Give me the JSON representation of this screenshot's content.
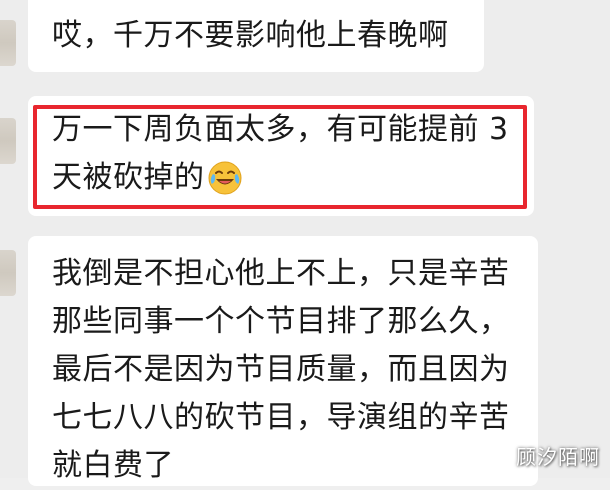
{
  "chat": {
    "messages": [
      {
        "lines": [
          "哎，千万不要影响他上春晚啊"
        ]
      },
      {
        "lines": [
          "万一下周负面太多，有可能提前 3",
          "天被砍掉的"
        ],
        "emoji": "crying-laughing-face-icon"
      },
      {
        "lines": [
          "我倒是不担心他上不上，只是辛苦",
          "那些同事一个个节目排了那么久，",
          "最后不是因为节目质量，而且因为",
          "七七八八的砍节目，导演组的辛苦",
          "就白费了"
        ]
      }
    ]
  },
  "highlight": {
    "color": "#e8262e"
  },
  "watermark": {
    "text": "顾汐陌啊"
  }
}
